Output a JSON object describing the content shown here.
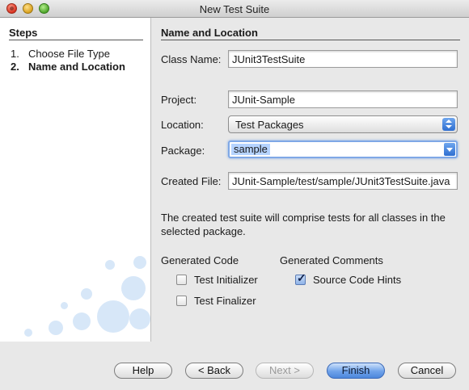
{
  "window": {
    "title": "New Test Suite"
  },
  "steps": {
    "heading": "Steps",
    "items": [
      {
        "num": "1.",
        "label": "Choose File Type"
      },
      {
        "num": "2.",
        "label": "Name and Location"
      }
    ]
  },
  "form": {
    "heading": "Name and Location",
    "class_name": {
      "label": "Class Name:",
      "value": "JUnit3TestSuite"
    },
    "project": {
      "label": "Project:",
      "value": "JUnit-Sample"
    },
    "location": {
      "label": "Location:",
      "value": "Test Packages"
    },
    "package": {
      "label": "Package:",
      "value": "sample"
    },
    "created_file": {
      "label": "Created File:",
      "value": "JUnit-Sample/test/sample/JUnit3TestSuite.java"
    },
    "description": "The created test suite will comprise tests for all classes in the selected package.",
    "generated_code": {
      "heading": "Generated Code",
      "test_initializer": {
        "label": "Test Initializer",
        "checked": false
      },
      "test_finalizer": {
        "label": "Test Finalizer",
        "checked": false
      }
    },
    "generated_comments": {
      "heading": "Generated Comments",
      "source_code_hints": {
        "label": "Source Code Hints",
        "checked": true
      }
    }
  },
  "buttons": {
    "help": "Help",
    "back": "< Back",
    "next": "Next >",
    "finish": "Finish",
    "cancel": "Cancel"
  },
  "colors": {
    "accent": "#4d87dc",
    "selection": "#b5d3ff"
  }
}
